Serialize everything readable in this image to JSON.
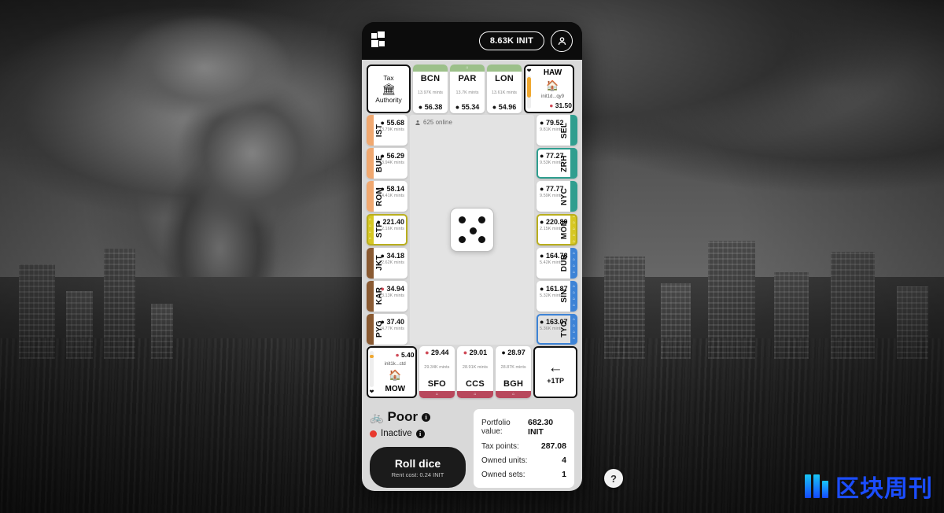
{
  "background": {
    "description": "grayscale post-apocalyptic cityscape with mushroom cloud"
  },
  "topbar": {
    "logo_icon": "brand-blocks-icon",
    "balance": "8.63K INIT",
    "profile_icon": "user-icon"
  },
  "board": {
    "online_icon": "person-icon",
    "online_label": "625 online",
    "dice": {
      "value": 5,
      "face_icon": "dice-five-icon"
    },
    "corner_tax": {
      "line1": "Tax",
      "icon": "bank-icon",
      "line2": "Authority"
    },
    "haw": {
      "code": "HAW",
      "heart_icon": "heart-icon",
      "house_icon": "house-icon",
      "address": "init1d...qy9",
      "price": "31.50",
      "meter_pct": 62,
      "meter_color": "#f0a830"
    },
    "mow": {
      "code": "MOW",
      "heart_icon": "heart-icon",
      "house_icon": "house-icon",
      "address": "init1k...ctd",
      "price": "5.40",
      "meter_pct": 10,
      "meter_color": "#f0a830"
    },
    "top_tiles": [
      {
        "code": "BCN",
        "mints": "13.97K mints",
        "price": "56.38",
        "accent": "#9cc08a",
        "icons": 0,
        "selected": false
      },
      {
        "code": "PAR",
        "mints": "13.7K mints",
        "price": "55.34",
        "accent": "#9cc08a",
        "icons": 1,
        "selected": false
      },
      {
        "code": "LON",
        "mints": "13.61K mints",
        "price": "54.96",
        "accent": "#9cc08a",
        "icons": 0,
        "selected": false
      }
    ],
    "left_tiles": [
      {
        "code": "IST",
        "mints": "13.79K mints",
        "price": "55.68",
        "accent": "#f0a870",
        "icons": 0,
        "selected": false,
        "red": false
      },
      {
        "code": "BUE",
        "mints": "13.94K mints",
        "price": "56.29",
        "accent": "#f0a870",
        "icons": 0,
        "selected": false,
        "red": false
      },
      {
        "code": "ROM",
        "mints": "14.41K mints",
        "price": "58.14",
        "accent": "#f0a870",
        "icons": 0,
        "selected": false,
        "red": false
      },
      {
        "code": "STP",
        "mints": "2.16K mints",
        "price": "221.40",
        "accent": "#d6c723",
        "icons": 4,
        "selected": true,
        "red": false
      },
      {
        "code": "JKT",
        "mints": "22.62K mints",
        "price": "34.18",
        "accent": "#8a5a32",
        "icons": 0,
        "selected": false,
        "red": false
      },
      {
        "code": "KAR",
        "mints": "23.13K mints",
        "price": "34.94",
        "accent": "#8a5a32",
        "icons": 0,
        "selected": false,
        "red": true
      },
      {
        "code": "PYG",
        "mints": "24.77K mints",
        "price": "37.40",
        "accent": "#8a5a32",
        "icons": 0,
        "selected": false,
        "red": false
      }
    ],
    "right_tiles": [
      {
        "code": "SEL",
        "mints": "9.81K mints",
        "price": "79.52",
        "accent": "#2f9e8f",
        "icons": 0,
        "selected": false
      },
      {
        "code": "ZRH",
        "mints": "9.53K mints",
        "price": "77.27",
        "accent": "#2f9e8f",
        "icons": 0,
        "selected": true
      },
      {
        "code": "NYC",
        "mints": "9.59K mints",
        "price": "77.77",
        "accent": "#2f9e8f",
        "icons": 0,
        "selected": false
      },
      {
        "code": "MON",
        "mints": "2.15K mints",
        "price": "220.80",
        "accent": "#d6c723",
        "icons": 5,
        "selected": true
      },
      {
        "code": "DUB",
        "mints": "5.42K mints",
        "price": "164.78",
        "accent": "#3d83d6",
        "icons": 4,
        "selected": false
      },
      {
        "code": "SIN",
        "mints": "5.32K mints",
        "price": "161.87",
        "accent": "#3d83d6",
        "icons": 4,
        "selected": false
      },
      {
        "code": "TYO",
        "mints": "5.36K mints",
        "price": "163.07",
        "accent": "#3d83d6",
        "icons": 4,
        "selected": true
      }
    ],
    "bottom_tiles": [
      {
        "code": "SFO",
        "mints": "29.34K mints",
        "price": "29.44",
        "accent": "#b8485c",
        "icons": 1,
        "red": true
      },
      {
        "code": "CCS",
        "mints": "28.91K mints",
        "price": "29.01",
        "accent": "#b8485c",
        "icons": 1,
        "red": true
      },
      {
        "code": "BGH",
        "mints": "28.87K mints",
        "price": "28.97",
        "accent": "#b8485c",
        "icons": 1,
        "red": false
      }
    ],
    "back_tile": {
      "arrow_icon": "arrow-left-icon",
      "label": "+1TP"
    }
  },
  "footer": {
    "rank_icon": "bicycle-icon",
    "rank_label": "Poor",
    "rank_info_icon": "info-icon",
    "status_label": "Inactive",
    "status_color": "#e8392e",
    "status_info_icon": "info-icon",
    "roll_button": {
      "label": "Roll dice",
      "sub": "Rent cost: 0.24 INIT"
    },
    "stats": [
      {
        "label": "Portfolio value:",
        "value": "682.30 INIT"
      },
      {
        "label": "Tax points:",
        "value": "287.08"
      },
      {
        "label": "Owned units:",
        "value": "4"
      },
      {
        "label": "Owned sets:",
        "value": "1"
      }
    ]
  },
  "help_button": {
    "icon": "question-mark-icon",
    "label": "?"
  },
  "watermark": {
    "text": "区块周刊",
    "logo_icon": "brand-bars-icon",
    "color": "#1b4dff"
  }
}
